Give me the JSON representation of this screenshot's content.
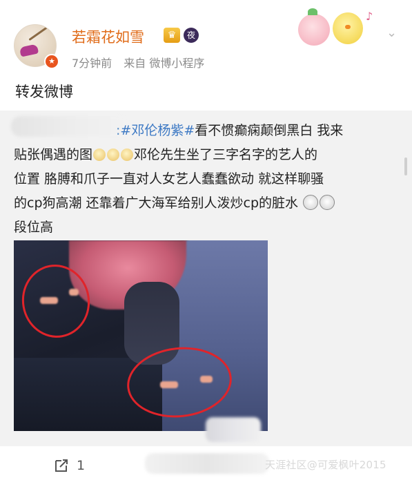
{
  "post": {
    "username": "若霜花如雪",
    "badge_crown": "♛",
    "badge_night": "夜",
    "vip_badge": "★",
    "time": "7分钟前",
    "source": "来自 微博小程序",
    "repost_text": "转发微博"
  },
  "quoted": {
    "hashtag": "#邓伦杨紫#",
    "line1_rest": "看不惯癫痫颠倒黑白 我来",
    "line2_a": "贴张偶遇的图",
    "line2_b": "邓伦先生坐了三字名字的艺人的",
    "line3": "位置 胳膊和爪子一直对人女艺人蠢蠢欲动  就这样聊骚",
    "line4": "的cp狗高潮 还靠着广大海军给别人泼炒cp的脏水",
    "line5": "段位高"
  },
  "footer": {
    "share_count": "1",
    "watermark": "天涯社区@可爱枫叶2015"
  },
  "icons": {
    "share": "share-icon",
    "chevron": "chevron-down-icon"
  },
  "colors": {
    "username": "#e06c1a",
    "hashtag": "#3d79c4",
    "annotation_circle": "#e0242a"
  }
}
